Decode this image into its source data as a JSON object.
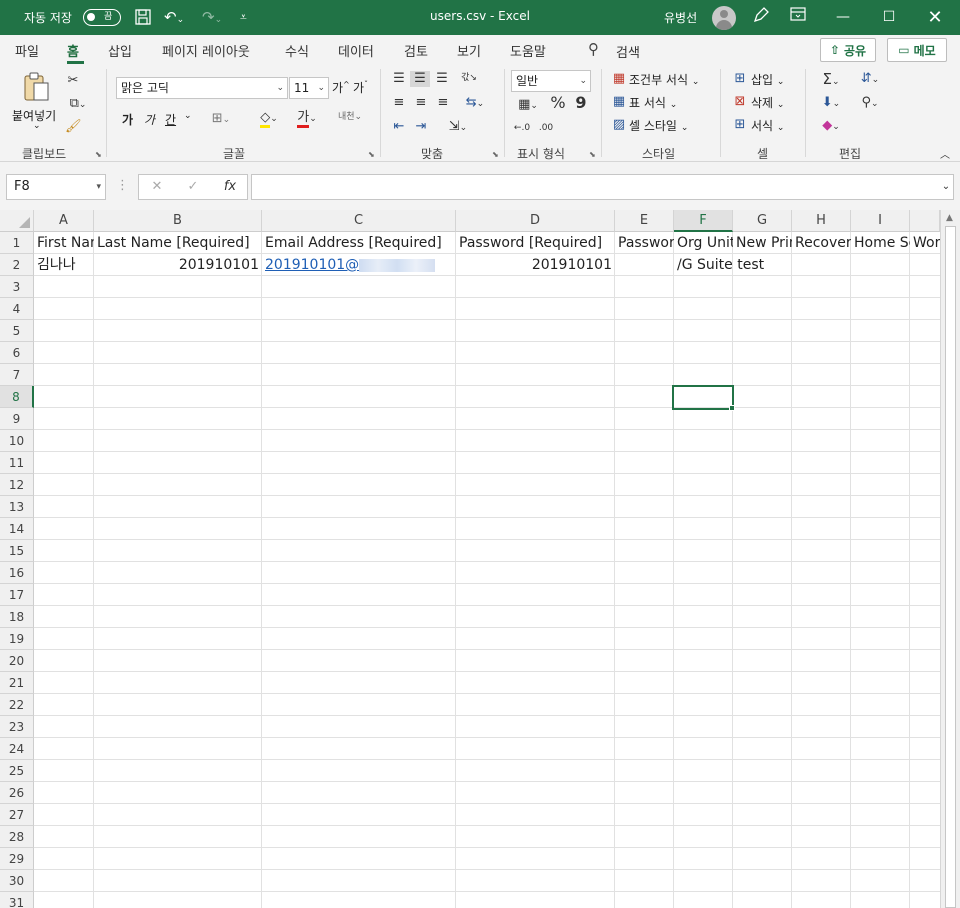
{
  "titlebar": {
    "autosave_label": "자동 저장",
    "autosave_state": "끔",
    "document_title": "users.csv  -  Excel",
    "user_name": "유병선"
  },
  "menu": {
    "tabs": [
      "파일",
      "홈",
      "삽입",
      "페이지 레이아웃",
      "수식",
      "데이터",
      "검토",
      "보기",
      "도움말"
    ],
    "active_tab": "홈",
    "search_label": "검색",
    "share_label": "공유",
    "comment_label": "메모"
  },
  "ribbon": {
    "clipboard": {
      "paste_label": "붙여넣기",
      "group_label": "클립보드"
    },
    "font": {
      "font_name": "맑은 고딕",
      "font_size": "11",
      "group_label": "글꼴",
      "bold": "가",
      "italic": "가",
      "underline": "간",
      "grow": "가",
      "shrink": "가",
      "fill_color_icon": "가"
    },
    "alignment": {
      "group_label": "맞춤"
    },
    "number": {
      "format": "일반",
      "group_label": "표시 형식"
    },
    "styles": {
      "conditional": "조건부 서식",
      "table": "표 서식",
      "cell_style": "셀 스타일",
      "group_label": "스타일"
    },
    "cells": {
      "insert": "삽입",
      "delete": "삭제",
      "format": "서식",
      "group_label": "셀"
    },
    "editing": {
      "group_label": "편집"
    }
  },
  "formula_bar": {
    "name_box": "F8",
    "formula": ""
  },
  "sheet": {
    "columns": [
      "A",
      "B",
      "C",
      "D",
      "E",
      "F",
      "G",
      "H",
      "I"
    ],
    "selected_column": "F",
    "selected_row": "8",
    "rows": [
      "1",
      "2",
      "3",
      "4",
      "5",
      "6",
      "7",
      "8",
      "9",
      "10",
      "11",
      "12",
      "13",
      "14",
      "15",
      "16",
      "17",
      "18",
      "19",
      "20",
      "21",
      "22",
      "23",
      "24",
      "25",
      "26",
      "27",
      "28",
      "29",
      "30",
      "31"
    ],
    "header_row": {
      "A": "First Name [Required]",
      "B": "Last Name [Required]",
      "C": "Email Address [Required]",
      "D": "Password [Required]",
      "E": "Password Hash Function",
      "F": "Org Unit Path",
      "G": "New Primary Email",
      "H": "Recovery Email",
      "I": "Home Secondary Email",
      "J": "Work Secondary Email"
    },
    "data_row": {
      "A": "김나나",
      "B": "201910101",
      "C": "201910101@",
      "D": "201910101",
      "F": "/G Suite test"
    }
  }
}
